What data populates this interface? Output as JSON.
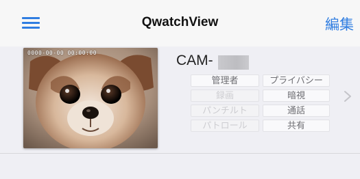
{
  "navbar": {
    "title": "QwatchView",
    "edit_label": "編集",
    "accent_color": "#2f7de1",
    "menu_icon": "hamburger-menu-icon"
  },
  "camera": {
    "name": "CAM-",
    "thumbnail_timestamp": "0000-00-00  00:00:00",
    "left_permissions": [
      {
        "label": "管理者",
        "enabled": true
      },
      {
        "label": "録画",
        "enabled": false
      },
      {
        "label": "パンチルト",
        "enabled": false
      },
      {
        "label": "パトロール",
        "enabled": false
      }
    ],
    "right_permissions": [
      {
        "label": "プライバシー",
        "enabled": true
      },
      {
        "label": "暗視",
        "enabled": true
      },
      {
        "label": "通話",
        "enabled": true
      },
      {
        "label": "共有",
        "enabled": true
      }
    ],
    "detail_icon": "chevron-right-icon"
  }
}
